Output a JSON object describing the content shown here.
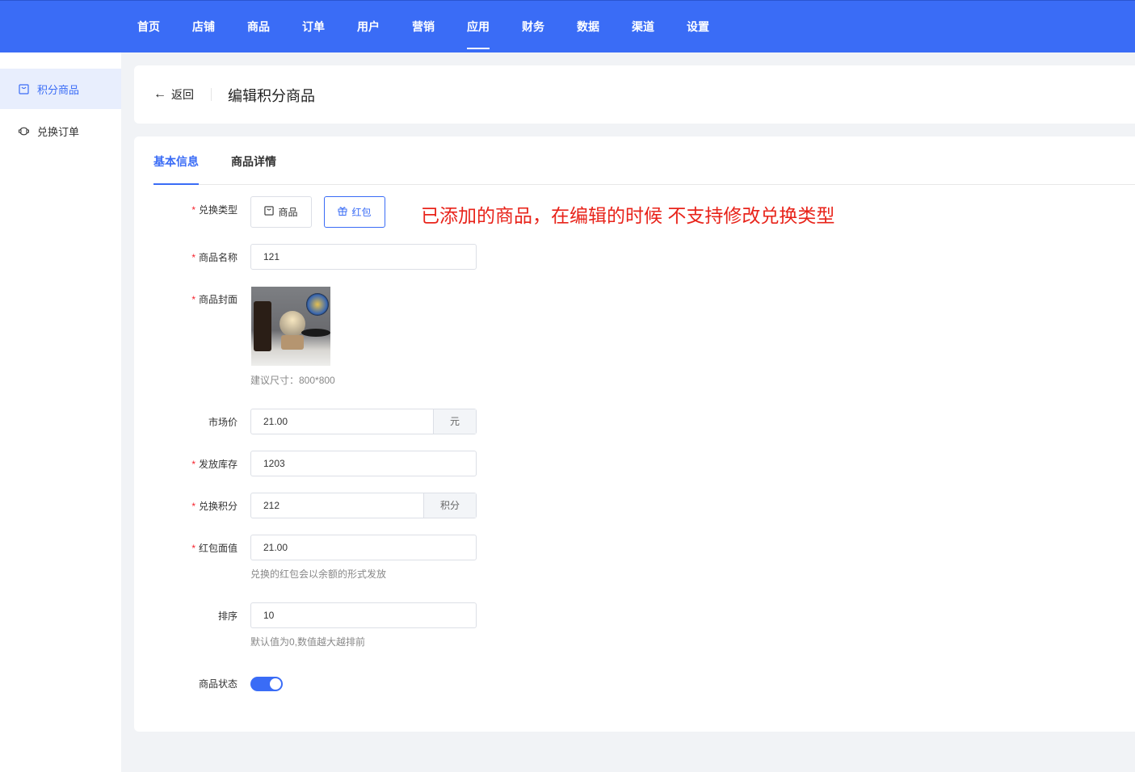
{
  "nav": {
    "items": [
      "首页",
      "店铺",
      "商品",
      "订单",
      "用户",
      "营销",
      "应用",
      "财务",
      "数据",
      "渠道",
      "设置"
    ],
    "active": "应用"
  },
  "sidebar": {
    "items": [
      {
        "label": "积分商品",
        "icon": "bag-icon"
      },
      {
        "label": "兑换订单",
        "icon": "exchange-icon"
      }
    ]
  },
  "header": {
    "back": "返回",
    "title": "编辑积分商品"
  },
  "tabs": [
    "基本信息",
    "商品详情"
  ],
  "form": {
    "type_label": "兑换类型",
    "type_options": [
      "商品",
      "红包"
    ],
    "type_selected": "红包",
    "annotation": "已添加的商品，在编辑的时候 不支持修改兑换类型",
    "name_label": "商品名称",
    "name_value": "121",
    "cover_label": "商品封面",
    "cover_hint": "建议尺寸：800*800",
    "market_label": "市场价",
    "market_value": "21.00",
    "market_suffix": "元",
    "stock_label": "发放库存",
    "stock_value": "1203",
    "points_label": "兑换积分",
    "points_value": "212",
    "points_suffix": "积分",
    "redpack_label": "红包面值",
    "redpack_value": "21.00",
    "redpack_hint": "兑换的红包会以余额的形式发放",
    "sort_label": "排序",
    "sort_value": "10",
    "sort_hint": "默认值为0,数值越大越排前",
    "status_label": "商品状态",
    "status_on": true
  },
  "colors": {
    "primary": "#3a6cf6",
    "required": "#f5222d",
    "annotation": "#e8231a"
  }
}
